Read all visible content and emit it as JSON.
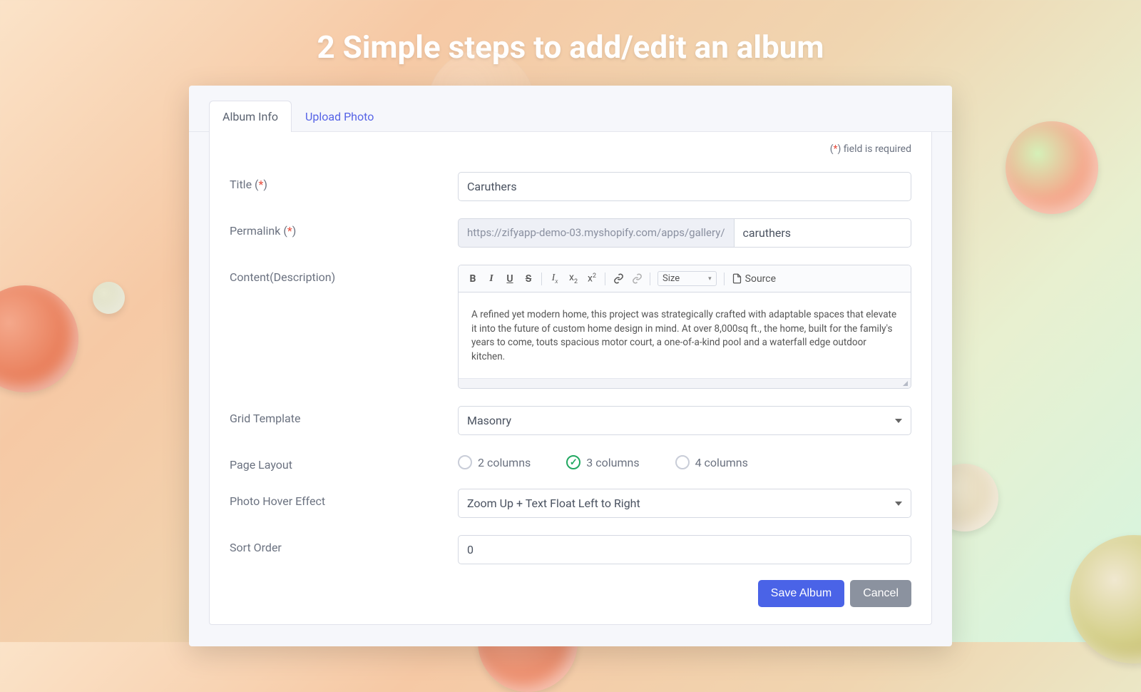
{
  "hero_title": "2 Simple steps to add/edit an album",
  "tabs": {
    "album_info": "Album Info",
    "upload_photo": "Upload Photo"
  },
  "required_note": "field is required",
  "labels": {
    "title": "Title",
    "permalink": "Permalink",
    "content": "Content(Description)",
    "grid_template": "Grid Template",
    "page_layout": "Page Layout",
    "hover_effect": "Photo Hover Effect",
    "sort_order": "Sort Order"
  },
  "values": {
    "title": "Caruthers",
    "permalink_prefix": "https://zifyapp-demo-03.myshopify.com/apps/gallery/",
    "permalink_slug": "caruthers",
    "description": "A refined yet modern home, this project was strategically crafted with adaptable spaces that elevate it into the future of custom home design in mind. At over 8,000sq ft., the home, built for the family's years to come, touts spacious motor court, a one-of-a-kind pool and a waterfall edge outdoor kitchen.",
    "grid_template": "Masonry",
    "hover_effect": "Zoom Up + Text Float Left to Right",
    "sort_order": "0"
  },
  "layout_options": {
    "col2": "2 columns",
    "col3": "3 columns",
    "col4": "4 columns",
    "selected": "col3"
  },
  "editor_toolbar": {
    "size_label": "Size",
    "source_label": "Source"
  },
  "buttons": {
    "save": "Save Album",
    "cancel": "Cancel"
  }
}
